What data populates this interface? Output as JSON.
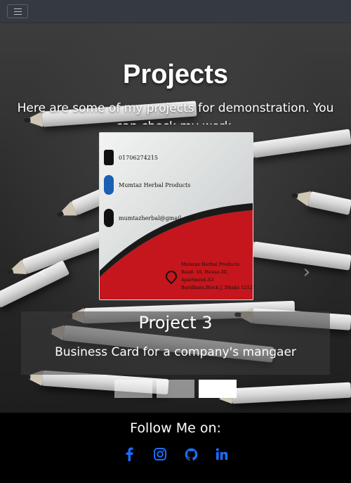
{
  "navbar": {
    "toggle_icon": "hamburger-icon"
  },
  "hero": {
    "title": "Projects",
    "subtitle": "Here are some of my projects for demonstration. You can check my work."
  },
  "carousel": {
    "active_index": 2,
    "slides_count": 3,
    "slide": {
      "title": "Project 3",
      "caption": "Business Card for a company's mangaer",
      "card": {
        "phone": "01706274215",
        "facebook": "Mumtaz Herbal Products",
        "email": "mumtazherbal@gmail.com",
        "company": "Mumtaz Herbal Products",
        "address_line1": "Road- 18, House-30, Apartment-A3",
        "address_line2": "Baridhara,Block J, Dhaka 1212"
      }
    },
    "prev_icon": "chevron-left-icon",
    "next_icon": "chevron-right-icon"
  },
  "footer": {
    "follow_label": "Follow Me on:",
    "social_icons": [
      "facebook-icon",
      "instagram-icon",
      "github-icon",
      "linkedin-icon"
    ],
    "icon_color": "#1a6dff"
  },
  "colors": {
    "navbar_bg": "#343a40",
    "card_red": "#c4161c"
  }
}
